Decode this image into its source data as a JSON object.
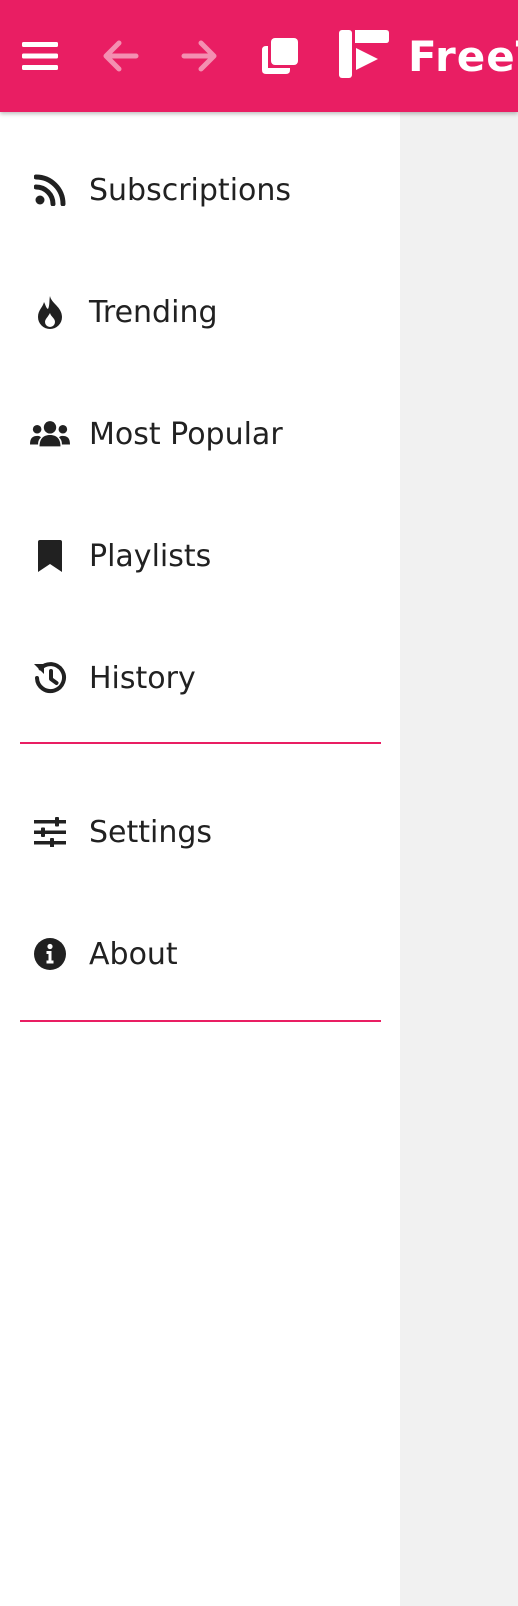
{
  "app": {
    "name": "FreeTube",
    "accent_color": "#e91e63"
  },
  "topbar": {
    "menu_icon": "hamburger-menu-icon",
    "back_icon": "arrow-left-icon",
    "forward_icon": "arrow-right-icon",
    "new_window_icon": "copy-window-icon",
    "logo_icon": "freetube-logo-icon",
    "logo_text": "FreeTube"
  },
  "sidebar": {
    "primary_items": [
      {
        "label": "Subscriptions",
        "icon": "rss-icon"
      },
      {
        "label": "Trending",
        "icon": "fire-icon"
      },
      {
        "label": "Most Popular",
        "icon": "users-icon"
      },
      {
        "label": "Playlists",
        "icon": "bookmark-icon"
      },
      {
        "label": "History",
        "icon": "history-icon"
      }
    ],
    "secondary_items": [
      {
        "label": "Settings",
        "icon": "sliders-icon"
      },
      {
        "label": "About",
        "icon": "info-circle-icon"
      }
    ]
  }
}
